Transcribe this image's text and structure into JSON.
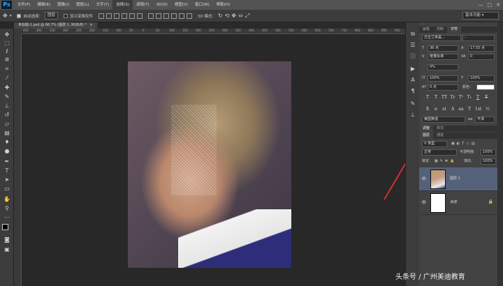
{
  "app": {
    "logo": "Ps"
  },
  "menu": [
    "文件(F)",
    "编辑(E)",
    "图像(I)",
    "图层(L)",
    "文字(Y)",
    "选择(S)",
    "滤镜(T)",
    "3D(D)",
    "视图(V)",
    "窗口(W)",
    "帮助(H)"
  ],
  "menu_active_index": 5,
  "window_controls": {
    "minimize": "—",
    "maximize": "□",
    "close": "✕"
  },
  "options": {
    "auto_select_label": "自动选择：",
    "auto_select_value": "图层",
    "show_transform_label": "显示变换控件",
    "mode_3d_label": "3D 模式：",
    "workspace": "基本功能"
  },
  "document": {
    "tab_title": "未标题-1.psd @ 66.7% (图层 1, RGB/8) *",
    "close": "×"
  },
  "ruler_ticks": [
    "450",
    "400",
    "350",
    "300",
    "250",
    "200",
    "150",
    "100",
    "50",
    "0",
    "50",
    "100",
    "150",
    "200",
    "250",
    "300",
    "350",
    "400",
    "450",
    "500",
    "550",
    "600",
    "650",
    "700",
    "750",
    "800",
    "850",
    "900",
    "950"
  ],
  "tools": [
    "move",
    "marquee",
    "lasso",
    "magic-wand",
    "crop",
    "eyedropper",
    "healing",
    "brush",
    "stamp",
    "history-brush",
    "eraser",
    "gradient",
    "blur",
    "dodge",
    "pen",
    "type",
    "path-select",
    "shape",
    "hand",
    "zoom"
  ],
  "char_panel": {
    "tabs": [
      "画笔",
      "仿制",
      "字符"
    ],
    "active_tab": 2,
    "font_family": "方正兰亭黑...",
    "font_style": "-",
    "font_size": "36 点",
    "leading": "17.55 点",
    "tracking_auto": "度量标准",
    "tracking": "0",
    "scale_pct": "0%",
    "vscale": "100%",
    "hscale": "100%",
    "baseline": "0 点",
    "color_label": "颜色：",
    "style_buttons": [
      "T",
      "T",
      "TT",
      "Tr",
      "T¹",
      "T₁",
      "T",
      "T"
    ],
    "extra_buttons": [
      "fi",
      "σ",
      "st",
      "A",
      "aa",
      "T",
      "1st",
      "½"
    ],
    "language": "美国英语",
    "aa_label": "aa",
    "aa_value": "平滑"
  },
  "adjust_tabs": [
    "调整",
    "样式"
  ],
  "layers_panel": {
    "tabs": [
      "图层",
      "通道"
    ],
    "active_tab": 0,
    "kind_label": "类型",
    "blend_mode": "正常",
    "opacity_label": "不透明度：",
    "opacity": "100%",
    "lock_label": "锁定：",
    "fill_label": "填充：",
    "fill": "100%",
    "layers": [
      {
        "name": "图层 1",
        "selected": true
      },
      {
        "name": "背景",
        "selected": false
      }
    ]
  },
  "watermark": "头条号 / 广州美迪教育",
  "colors": {
    "accent_arrow": "#d33030",
    "selected_layer": "#556079"
  }
}
